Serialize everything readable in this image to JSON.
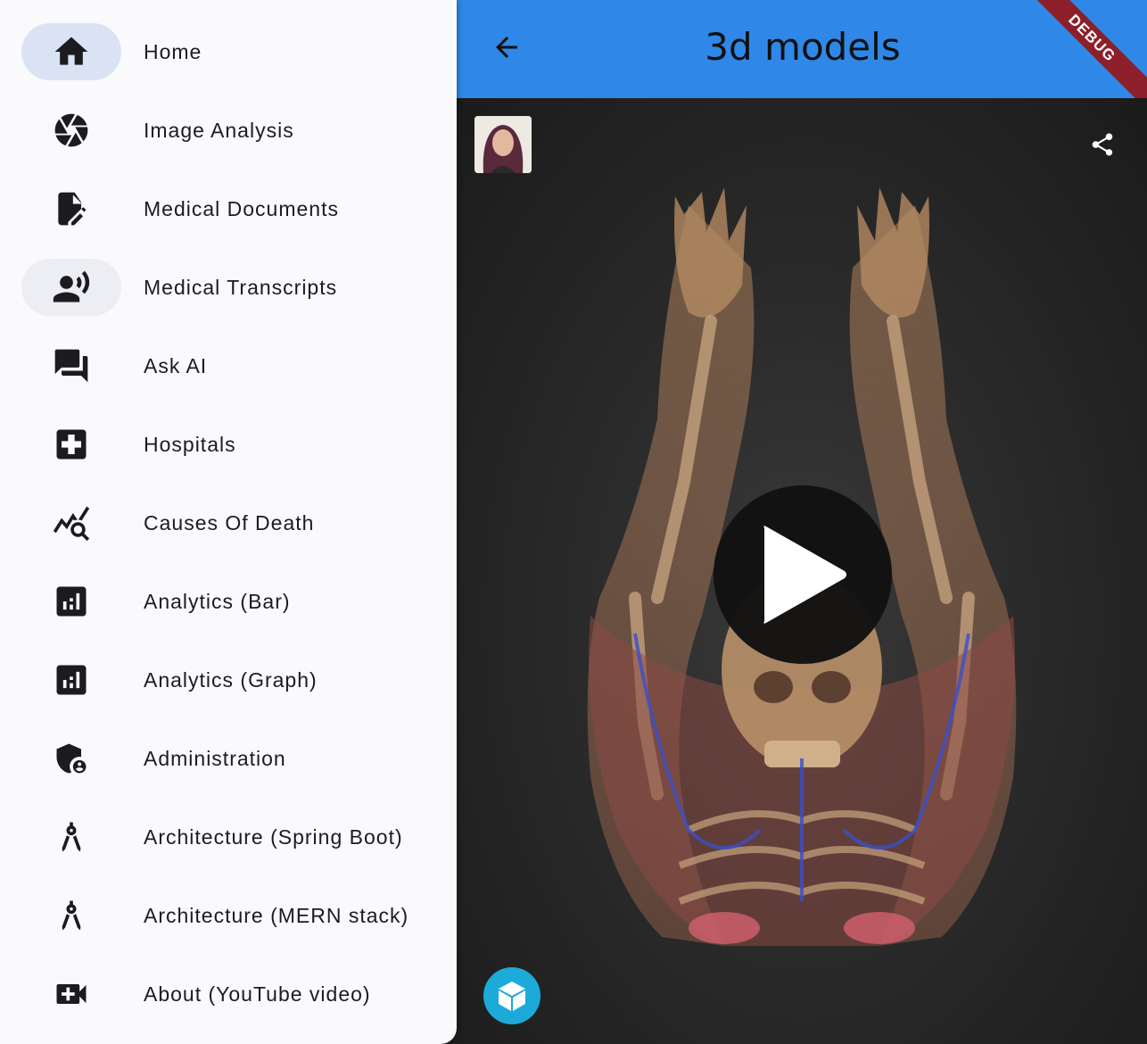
{
  "appbar": {
    "title": "3d models",
    "back_icon": "arrow-back-icon",
    "color": "#2f88e8"
  },
  "debug_banner": {
    "text": "DEBUG",
    "color": "#8d1f2a"
  },
  "viewer": {
    "share_icon": "share-icon",
    "play_icon": "play-icon",
    "logo_icon": "cube-icon"
  },
  "drawer": {
    "items": [
      {
        "label": "Home",
        "icon": "home-icon"
      },
      {
        "label": "Image Analysis",
        "icon": "camera-shutter-icon"
      },
      {
        "label": "Medical Documents",
        "icon": "edit-document-icon"
      },
      {
        "label": "Medical Transcripts",
        "icon": "record-voice-icon"
      },
      {
        "label": "Ask AI",
        "icon": "forum-icon"
      },
      {
        "label": "Hospitals",
        "icon": "local-hospital-icon"
      },
      {
        "label": "Causes Of Death",
        "icon": "query-stats-icon"
      },
      {
        "label": "Analytics (Bar)",
        "icon": "bar-chart-icon"
      },
      {
        "label": "Analytics (Graph)",
        "icon": "bar-chart-icon"
      },
      {
        "label": "Administration",
        "icon": "admin-shield-icon"
      },
      {
        "label": "Architecture (Spring Boot)",
        "icon": "compass-icon"
      },
      {
        "label": "Architecture (MERN stack)",
        "icon": "compass-icon"
      },
      {
        "label": "About (YouTube video)",
        "icon": "video-call-icon"
      }
    ]
  }
}
